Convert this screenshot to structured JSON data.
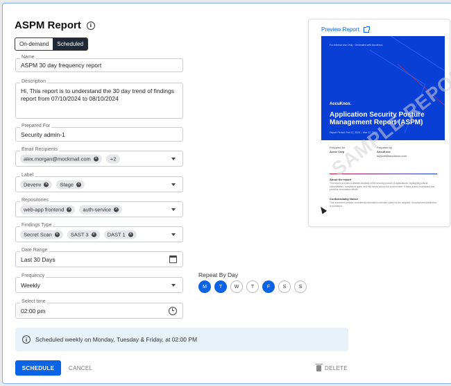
{
  "page": {
    "title": "ASPM Report",
    "mode_tabs": [
      {
        "label": "On-demand",
        "active": false
      },
      {
        "label": "Scheduled",
        "active": true
      }
    ]
  },
  "form": {
    "name": {
      "label": "Name",
      "value": "ASPM 30 day frequency report"
    },
    "description": {
      "label": "Description",
      "value": "Hi, This report is to understand the 30 day trend of findings report from 07/10/2024 to 08/10/2024"
    },
    "prepared_for": {
      "label": "Prepared For",
      "value": "Security admin-1"
    },
    "email_recipients": {
      "label": "Email Recipients",
      "chips": [
        "alex.morgan@mockmail.com"
      ],
      "more": "+2"
    },
    "label": {
      "label": "Label",
      "chips": [
        "Devenv",
        "Stage"
      ]
    },
    "repositories": {
      "label": "Repositories",
      "chips": [
        "web-app frontend",
        "auth-service"
      ]
    },
    "findings_type": {
      "label": "Findings Type",
      "chips": [
        "Secret Scan",
        "SAST 3",
        "DAST 1"
      ]
    },
    "date_range": {
      "label": "Date Range",
      "value": "Last 30 Days"
    },
    "frequency": {
      "label": "Frequency",
      "value": "Weekly"
    },
    "select_time": {
      "label": "Select time",
      "value": "02:00 pm"
    }
  },
  "repeat": {
    "label": "Repeat By Day",
    "days": [
      {
        "letter": "M",
        "on": true
      },
      {
        "letter": "T",
        "on": true
      },
      {
        "letter": "W",
        "on": false
      },
      {
        "letter": "T",
        "on": false
      },
      {
        "letter": "F",
        "on": true
      },
      {
        "letter": "S",
        "on": false
      },
      {
        "letter": "S",
        "on": false
      }
    ]
  },
  "banner": {
    "text": "Scheduled weekly on Monday, Tuesday & Friday, at 02:00 PM"
  },
  "actions": {
    "schedule": "SCHEDULE",
    "cancel": "CANCEL",
    "delete": "DELETE"
  },
  "preview": {
    "link": "Preview Report",
    "cover_top": "For Internal Use Only · Generated with AccuKnox",
    "brand": "AccuKnox.",
    "cover_title": "Application Security Posture Management Report (ASPM)",
    "cover_sub": "Report Period: Feb 12, 2024 – Mar 12, 2024",
    "prepared_for_h": "Prepared for",
    "prepared_for_v": "Acme Corp",
    "prepared_by_h": "Prepared by",
    "prepared_by_v": "AccuKnox",
    "prepared_by_email": "support@accuknox.com",
    "section1_h": "About the report",
    "section1_p": "This report provides a detailed analysis of the security posture of applications, highlighting critical vulnerabilities, compliance gaps, and risk trends across the environment. It helps teams understand and prioritize remediation efforts.",
    "section2_h": "Confidentiality Notice",
    "section2_p": "This document contains confidential information intended solely for the recipient. Unauthorized distribution is prohibited.",
    "watermark": "SAMPLE REPORT"
  },
  "colors": {
    "primary": "#0b63e5",
    "cover": "#0a3fd6",
    "banner": "#e7f2fb"
  }
}
